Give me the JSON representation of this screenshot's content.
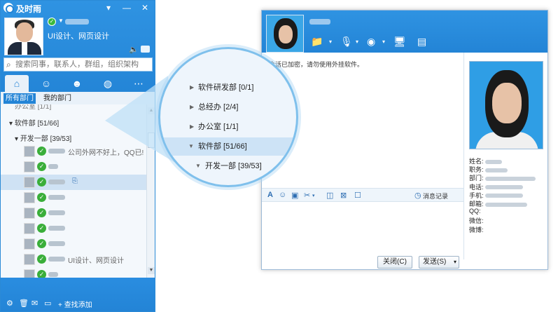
{
  "app": {
    "name": "及时雨",
    "signature": "UI设计、网页设计",
    "window_controls": [
      "▾",
      "—",
      "✕"
    ]
  },
  "search": {
    "placeholder": "搜索同事，联系人，群组，组织架构"
  },
  "tabs": [
    "home-icon",
    "user-icon",
    "contacts-icon",
    "globe-icon",
    "chat-icon"
  ],
  "subtabs": [
    "所有部门",
    "我的部门"
  ],
  "tree": {
    "partial_row": "办公室  [1/1]",
    "dept": "软件部 [51/66]",
    "subdept": "开发一部  [39/53]",
    "contacts": [
      {
        "status": "online",
        "text": "公司外网不好上，QQ已!"
      },
      {
        "status": "online",
        "text": ""
      },
      {
        "status": "online",
        "text": "",
        "selected": true
      },
      {
        "status": "online",
        "text": ""
      },
      {
        "status": "online",
        "text": ""
      },
      {
        "status": "online",
        "text": ""
      },
      {
        "status": "online",
        "text": ""
      },
      {
        "status": "online",
        "text": "UI设计、网页设计"
      },
      {
        "status": "online",
        "text": ""
      },
      {
        "status": "online",
        "text": ""
      }
    ]
  },
  "bottom": {
    "icons": [
      "gear-icon",
      "trash-icon",
      "message-icon",
      "folder-icon"
    ],
    "add_find": "查找添加"
  },
  "magnifier": {
    "rows": [
      {
        "label": "软件研发部  [0/1]",
        "arrow": "right",
        "indent": 1
      },
      {
        "label": "总经办  [2/4]",
        "arrow": "right",
        "indent": 1
      },
      {
        "label": "办公室  [1/1]",
        "arrow": "right",
        "indent": 1
      },
      {
        "label": "软件部  [51/66]",
        "arrow": "down",
        "indent": 1,
        "selected": true
      },
      {
        "label": "开发一部  [39/53]",
        "arrow": "down",
        "indent": 2
      }
    ]
  },
  "chat": {
    "notice": "会话已加密，请勿使用外挂软件。",
    "history_label": "消息记录",
    "close_label": "关闭(C)",
    "send_label": "发送(S)",
    "profile_fields": [
      "姓名:",
      "职务:",
      "部门:",
      "电话:",
      "手机:",
      "邮箱:",
      "QQ:",
      "微信:",
      "微博:"
    ]
  },
  "colors": {
    "accent": "#2384d6",
    "online": "#3aae3a",
    "panel": "#e9f1f9"
  }
}
